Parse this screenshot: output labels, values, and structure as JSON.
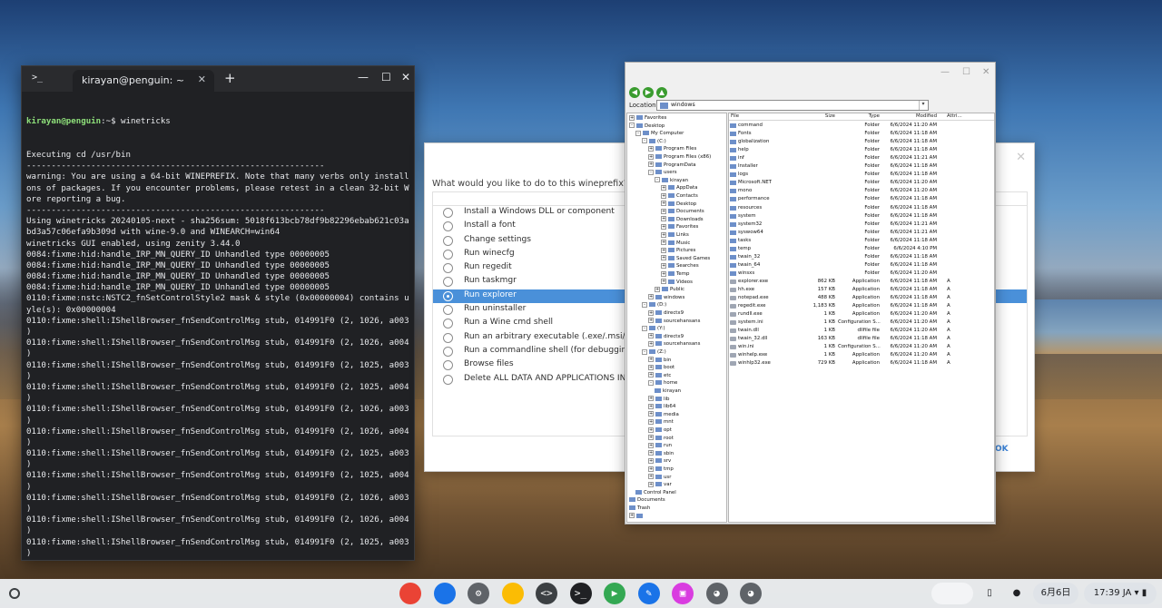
{
  "terminal": {
    "tab_title": "kirayan@penguin: ~",
    "prompt_user": "kirayan@penguin",
    "prompt_rest": ":~$ winetricks",
    "lines": [
      "Executing cd /usr/bin",
      "------------------------------------------------------------",
      "warning: You are using a 64-bit WINEPREFIX. Note that many verbs only install 32-bit versi",
      "ons of packages. If you encounter problems, please retest in a clean 32-bit WINEPREFIX bef",
      "ore reporting a bug.",
      "------------------------------------------------------------",
      "Using winetricks 20240105-next - sha256sum: 5018f613bcb78df9b82296ebab621c03a9282c00140ffa",
      "bd3a57c06efa9b309d with wine-9.0 and WINEARCH=win64",
      "winetricks GUI enabled, using zenity 3.44.0",
      "0084:fixme:hid:handle_IRP_MN_QUERY_ID Unhandled type 00000005",
      "0084:fixme:hid:handle_IRP_MN_QUERY_ID Unhandled type 00000005",
      "0084:fixme:hid:handle_IRP_MN_QUERY_ID Unhandled type 00000005",
      "0084:fixme:hid:handle_IRP_MN_QUERY_ID Unhandled type 00000005",
      "0110:fixme:nstc:NSTC2_fnSetControlStyle2 mask & style (0x00000004) contains unsupported st",
      "yle(s): 0x00000004",
      "0110:fixme:shell:IShellBrowser_fnSendControlMsg stub, 014991F0 (2, 1026, a003, 0, 0069F6AC",
      ")",
      "0110:fixme:shell:IShellBrowser_fnSendControlMsg stub, 014991F0 (2, 1026, a004, 1, 0069F6AC",
      ")",
      "0110:fixme:shell:IShellBrowser_fnSendControlMsg stub, 014991F0 (2, 1025, a003, 1, 0069F6AC",
      ")",
      "0110:fixme:shell:IShellBrowser_fnSendControlMsg stub, 014991F0 (2, 1025, a004, 1, 0069F6AC",
      ")",
      "0110:fixme:shell:IShellBrowser_fnSendControlMsg stub, 014991F0 (2, 1026, a003, 0, 0069EB88",
      ")",
      "0110:fixme:shell:IShellBrowser_fnSendControlMsg stub, 014991F0 (2, 1026, a004, 1, 0069EB88",
      ")",
      "0110:fixme:shell:IShellBrowser_fnSendControlMsg stub, 014991F0 (2, 1025, a003, 1, 0069EB88",
      ")",
      "0110:fixme:shell:IShellBrowser_fnSendControlMsg stub, 014991F0 (2, 1025, a004, 1, 0069EB88",
      ")",
      "0110:fixme:shell:IShellBrowser_fnSendControlMsg stub, 014991F0 (2, 1026, a003, 0, 0069EF84",
      ")",
      "0110:fixme:shell:IShellBrowser_fnSendControlMsg stub, 014991F0 (2, 1026, a004, 1, 0069EF84",
      ")",
      "0110:fixme:shell:IShellBrowser_fnSendControlMsg stub, 014991F0 (2, 1025, a003, 1, 0069EF84",
      ")",
      "0110:fixme:shell:IShellBrowser_fnSendControlMsg stub, 014991F0 (2, 1025, a004, 1, 0069EF84",
      ")",
      "0110:err:pidl:_ILSimpleGetText -- no text",
      "0110:err:pidl:_ILSimpleGetText -- no text"
    ]
  },
  "winetricks": {
    "question": "What would you like to do to this wineprefix?",
    "options": [
      "Install a Windows DLL or component",
      "Install a font",
      "Change settings",
      "Run winecfg",
      "Run regedit",
      "Run taskmgr",
      "Run explorer",
      "Run uninstaller",
      "Run a Wine cmd shell",
      "Run an arbitrary executable (.exe/.msi/.msu)",
      "Run a commandline shell (for debugging)",
      "Browse files",
      "Delete ALL DATA AND APPLICATIONS INSIDE"
    ],
    "selected_index": 6,
    "ok_label": "OK"
  },
  "explorer": {
    "location_label": "Location:",
    "location_value": "windows",
    "tree": [
      {
        "label": "Favorites",
        "depth": 0,
        "exp": "+"
      },
      {
        "label": "Desktop",
        "depth": 0,
        "exp": "-"
      },
      {
        "label": "My Computer",
        "depth": 1,
        "exp": "-"
      },
      {
        "label": "(C:)",
        "depth": 2,
        "exp": "-"
      },
      {
        "label": "Program Files",
        "depth": 3,
        "exp": "+"
      },
      {
        "label": "Program Files (x86)",
        "depth": 3,
        "exp": "+"
      },
      {
        "label": "ProgramData",
        "depth": 3,
        "exp": "+"
      },
      {
        "label": "users",
        "depth": 3,
        "exp": "-"
      },
      {
        "label": "kirayan",
        "depth": 4,
        "exp": "-"
      },
      {
        "label": "AppData",
        "depth": 5,
        "exp": "+"
      },
      {
        "label": "Contacts",
        "depth": 5,
        "exp": "+"
      },
      {
        "label": "Desktop",
        "depth": 5,
        "exp": "+"
      },
      {
        "label": "Documents",
        "depth": 5,
        "exp": "+"
      },
      {
        "label": "Downloads",
        "depth": 5,
        "exp": "+"
      },
      {
        "label": "Favorites",
        "depth": 5,
        "exp": "+"
      },
      {
        "label": "Links",
        "depth": 5,
        "exp": "+"
      },
      {
        "label": "Music",
        "depth": 5,
        "exp": "+"
      },
      {
        "label": "Pictures",
        "depth": 5,
        "exp": "+"
      },
      {
        "label": "Saved Games",
        "depth": 5,
        "exp": "+"
      },
      {
        "label": "Searches",
        "depth": 5,
        "exp": "+"
      },
      {
        "label": "Temp",
        "depth": 5,
        "exp": "+"
      },
      {
        "label": "Videos",
        "depth": 5,
        "exp": "+"
      },
      {
        "label": "Public",
        "depth": 4,
        "exp": "+"
      },
      {
        "label": "windows",
        "depth": 3,
        "exp": "+"
      },
      {
        "label": "(D:)",
        "depth": 2,
        "exp": "-"
      },
      {
        "label": "directx9",
        "depth": 3,
        "exp": "+"
      },
      {
        "label": "sourcehansans",
        "depth": 3,
        "exp": "+"
      },
      {
        "label": "(Y:)",
        "depth": 2,
        "exp": "-"
      },
      {
        "label": "directx9",
        "depth": 3,
        "exp": "+"
      },
      {
        "label": "sourcehansans",
        "depth": 3,
        "exp": "+"
      },
      {
        "label": "(Z:)",
        "depth": 2,
        "exp": "-"
      },
      {
        "label": "bin",
        "depth": 3,
        "exp": "+"
      },
      {
        "label": "boot",
        "depth": 3,
        "exp": "+"
      },
      {
        "label": "etc",
        "depth": 3,
        "exp": "+"
      },
      {
        "label": "home",
        "depth": 3,
        "exp": "-"
      },
      {
        "label": "kirayan",
        "depth": 4,
        "exp": ""
      },
      {
        "label": "lib",
        "depth": 3,
        "exp": "+"
      },
      {
        "label": "lib64",
        "depth": 3,
        "exp": "+"
      },
      {
        "label": "media",
        "depth": 3,
        "exp": "+"
      },
      {
        "label": "mnt",
        "depth": 3,
        "exp": "+"
      },
      {
        "label": "opt",
        "depth": 3,
        "exp": "+"
      },
      {
        "label": "root",
        "depth": 3,
        "exp": "+"
      },
      {
        "label": "run",
        "depth": 3,
        "exp": "+"
      },
      {
        "label": "sbin",
        "depth": 3,
        "exp": "+"
      },
      {
        "label": "srv",
        "depth": 3,
        "exp": "+"
      },
      {
        "label": "tmp",
        "depth": 3,
        "exp": "+"
      },
      {
        "label": "usr",
        "depth": 3,
        "exp": "+"
      },
      {
        "label": "var",
        "depth": 3,
        "exp": "+"
      },
      {
        "label": "Control Panel",
        "depth": 1,
        "exp": ""
      },
      {
        "label": "Documents",
        "depth": 0,
        "exp": ""
      },
      {
        "label": "Trash",
        "depth": 0,
        "exp": ""
      },
      {
        "label": "",
        "depth": 0,
        "exp": "+"
      }
    ],
    "columns": [
      "File",
      "Size",
      "Type",
      "Modified",
      "Attri..."
    ],
    "files": [
      {
        "name": "command",
        "size": "",
        "type": "Folder",
        "modified": "6/6/2024 11:20 AM",
        "attr": "",
        "kind": "folder"
      },
      {
        "name": "Fonts",
        "size": "",
        "type": "Folder",
        "modified": "6/6/2024 11:18 AM",
        "attr": "",
        "kind": "folder"
      },
      {
        "name": "globalization",
        "size": "",
        "type": "Folder",
        "modified": "6/6/2024 11:18 AM",
        "attr": "",
        "kind": "folder"
      },
      {
        "name": "help",
        "size": "",
        "type": "Folder",
        "modified": "6/6/2024 11:18 AM",
        "attr": "",
        "kind": "folder"
      },
      {
        "name": "inf",
        "size": "",
        "type": "Folder",
        "modified": "6/6/2024 11:21 AM",
        "attr": "",
        "kind": "folder"
      },
      {
        "name": "Installer",
        "size": "",
        "type": "Folder",
        "modified": "6/6/2024 11:18 AM",
        "attr": "",
        "kind": "folder"
      },
      {
        "name": "logs",
        "size": "",
        "type": "Folder",
        "modified": "6/6/2024 11:18 AM",
        "attr": "",
        "kind": "folder"
      },
      {
        "name": "Microsoft.NET",
        "size": "",
        "type": "Folder",
        "modified": "6/6/2024 11:20 AM",
        "attr": "",
        "kind": "folder"
      },
      {
        "name": "mono",
        "size": "",
        "type": "Folder",
        "modified": "6/6/2024 11:20 AM",
        "attr": "",
        "kind": "folder"
      },
      {
        "name": "performance",
        "size": "",
        "type": "Folder",
        "modified": "6/6/2024 11:18 AM",
        "attr": "",
        "kind": "folder"
      },
      {
        "name": "resources",
        "size": "",
        "type": "Folder",
        "modified": "6/6/2024 11:18 AM",
        "attr": "",
        "kind": "folder"
      },
      {
        "name": "system",
        "size": "",
        "type": "Folder",
        "modified": "6/6/2024 11:18 AM",
        "attr": "",
        "kind": "folder"
      },
      {
        "name": "system32",
        "size": "",
        "type": "Folder",
        "modified": "6/6/2024 11:21 AM",
        "attr": "",
        "kind": "folder"
      },
      {
        "name": "syswow64",
        "size": "",
        "type": "Folder",
        "modified": "6/6/2024 11:21 AM",
        "attr": "",
        "kind": "folder"
      },
      {
        "name": "tasks",
        "size": "",
        "type": "Folder",
        "modified": "6/6/2024 11:18 AM",
        "attr": "",
        "kind": "folder"
      },
      {
        "name": "temp",
        "size": "",
        "type": "Folder",
        "modified": "6/6/2024 4:10 PM",
        "attr": "",
        "kind": "folder"
      },
      {
        "name": "twain_32",
        "size": "",
        "type": "Folder",
        "modified": "6/6/2024 11:18 AM",
        "attr": "",
        "kind": "folder"
      },
      {
        "name": "twain_64",
        "size": "",
        "type": "Folder",
        "modified": "6/6/2024 11:18 AM",
        "attr": "",
        "kind": "folder"
      },
      {
        "name": "winsxs",
        "size": "",
        "type": "Folder",
        "modified": "6/6/2024 11:20 AM",
        "attr": "",
        "kind": "folder"
      },
      {
        "name": "explorer.exe",
        "size": "862 KB",
        "type": "Application",
        "modified": "6/6/2024 11:18 AM",
        "attr": "A",
        "kind": "app"
      },
      {
        "name": "hh.exe",
        "size": "157 KB",
        "type": "Application",
        "modified": "6/6/2024 11:18 AM",
        "attr": "A",
        "kind": "app"
      },
      {
        "name": "notepad.exe",
        "size": "488 KB",
        "type": "Application",
        "modified": "6/6/2024 11:18 AM",
        "attr": "A",
        "kind": "app"
      },
      {
        "name": "regedit.exe",
        "size": "1,183 KB",
        "type": "Application",
        "modified": "6/6/2024 11:18 AM",
        "attr": "A",
        "kind": "app"
      },
      {
        "name": "rundll.exe",
        "size": "1 KB",
        "type": "Application",
        "modified": "6/6/2024 11:20 AM",
        "attr": "A",
        "kind": "app"
      },
      {
        "name": "system.ini",
        "size": "1 KB",
        "type": "Configuration S...",
        "modified": "6/6/2024 11:20 AM",
        "attr": "A",
        "kind": "app"
      },
      {
        "name": "twain.dll",
        "size": "1 KB",
        "type": "dllfile file",
        "modified": "6/6/2024 11:20 AM",
        "attr": "A",
        "kind": "app"
      },
      {
        "name": "twain_32.dll",
        "size": "163 KB",
        "type": "dllfile file",
        "modified": "6/6/2024 11:18 AM",
        "attr": "A",
        "kind": "app"
      },
      {
        "name": "win.ini",
        "size": "1 KB",
        "type": "Configuration S...",
        "modified": "6/6/2024 11:20 AM",
        "attr": "A",
        "kind": "app"
      },
      {
        "name": "winhelp.exe",
        "size": "1 KB",
        "type": "Application",
        "modified": "6/6/2024 11:20 AM",
        "attr": "A",
        "kind": "app"
      },
      {
        "name": "winhlp32.exe",
        "size": "729 KB",
        "type": "Application",
        "modified": "6/6/2024 11:18 AM",
        "attr": "A",
        "kind": "app"
      }
    ]
  },
  "shelf": {
    "apps": [
      {
        "name": "chrome-icon",
        "color": "#ea4335",
        "glyph": ""
      },
      {
        "name": "files-icon",
        "color": "#1a73e8",
        "glyph": ""
      },
      {
        "name": "settings-icon",
        "color": "#5f6368",
        "glyph": "⚙"
      },
      {
        "name": "photos-icon",
        "color": "#fbbc04",
        "glyph": ""
      },
      {
        "name": "text-editor-icon",
        "color": "#3c4043",
        "glyph": "<>"
      },
      {
        "name": "terminal-icon",
        "color": "#202124",
        "glyph": ">_"
      },
      {
        "name": "play-store-icon",
        "color": "#34a853",
        "glyph": "▶"
      },
      {
        "name": "wine-app-icon",
        "color": "#1a73e8",
        "glyph": "✎"
      },
      {
        "name": "media-app-icon",
        "color": "#d93ce0",
        "glyph": "▣"
      },
      {
        "name": "linux-penguin-icon",
        "color": "#5f6368",
        "glyph": "◕"
      },
      {
        "name": "linux-penguin-icon-2",
        "color": "#5f6368",
        "glyph": "◕"
      }
    ],
    "date": "6月6日",
    "time": "17:39",
    "ime": "JA"
  }
}
